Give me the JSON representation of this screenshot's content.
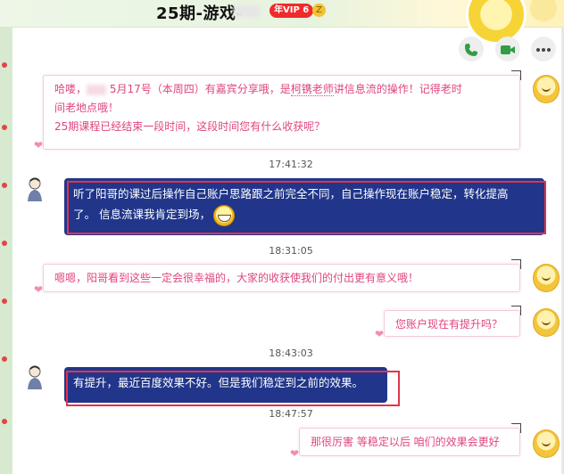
{
  "window": {
    "title": "25期-游戏-",
    "vip_badge": "年VIP 6",
    "vip_extra": "Z"
  },
  "actions": [
    {
      "name": "voice-call"
    },
    {
      "name": "video-call"
    },
    {
      "name": "more"
    }
  ],
  "messages": [
    {
      "side": "right",
      "lines": [
        "哈喽，",
        "5月17号（本周四）有嘉宾分享哦，是",
        "柯镌老师",
        "讲信息流的操作！记得老时",
        "间老地点哦！",
        "25期课程已经结束一段时间，这段时间您有什么收获呢？"
      ]
    },
    {
      "time": "17:41:32"
    },
    {
      "side": "left",
      "lines": [
        "听了阳哥的课过后操作自己账户思路跟之前完全不同，自己操作现在账户稳定，转化提高",
        "了。 信息流课我肯定到场，"
      ]
    },
    {
      "time": "18:31:05"
    },
    {
      "side": "right",
      "lines": [
        "嗯嗯，阳哥看到这些一定会很幸福的，大家的收获使我们的付出更有意义哦！"
      ]
    },
    {
      "side": "right",
      "lines": [
        "您账户现在有提升吗？"
      ]
    },
    {
      "time": "18:43:03"
    },
    {
      "side": "left",
      "lines": [
        "有提升，最近百度效果不好。但是我们稳定到之前的效果。"
      ]
    },
    {
      "time": "18:47:57"
    },
    {
      "side": "right",
      "lines": [
        "那很厉害 等稳定以后 咱们的效果会更好"
      ]
    }
  ],
  "colors": {
    "outgoing_text": "#e0447f",
    "incoming_bubble": "#21368a",
    "highlight_box": "#e0344b",
    "title_bg": "#eef7e7"
  }
}
